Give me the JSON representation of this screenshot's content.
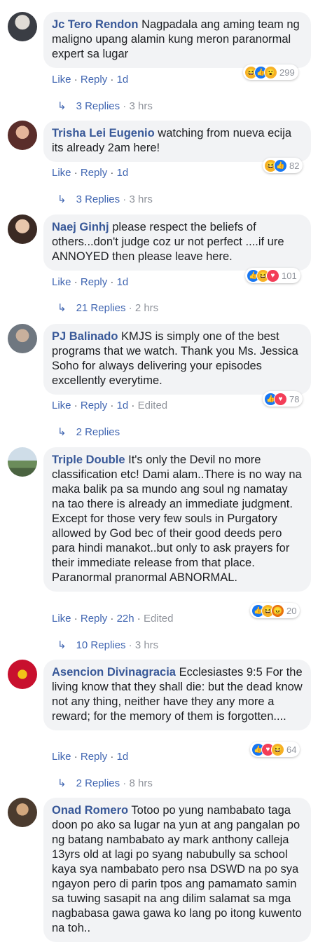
{
  "comments": [
    {
      "author": "Jc Tero Rendon",
      "text": "Nagpadala ang aming team ng maligno upang alamin kung meron paranormal expert sa lugar",
      "reactions": [
        "haha",
        "like",
        "wow"
      ],
      "count": "299",
      "like": "Like",
      "reply": "Reply",
      "time": "1d",
      "edited": "",
      "replies_label": "3 Replies",
      "replies_time": "3 hrs"
    },
    {
      "author": "Trisha Lei Eugenio",
      "text": "watching from nueva ecija its already 2am here!",
      "reactions": [
        "haha",
        "like"
      ],
      "count": "82",
      "like": "Like",
      "reply": "Reply",
      "time": "1d",
      "edited": "",
      "replies_label": "3 Replies",
      "replies_time": "3 hrs"
    },
    {
      "author": "Naej Ginhj",
      "text": "please respect the beliefs of others...don't judge coz ur not perfect ....if ure ANNOYED then please leave here.",
      "reactions": [
        "like",
        "haha",
        "love"
      ],
      "count": "101",
      "like": "Like",
      "reply": "Reply",
      "time": "1d",
      "edited": "",
      "replies_label": "21 Replies",
      "replies_time": "2 hrs"
    },
    {
      "author": "PJ Balinado",
      "text": "KMJS is simply one of the best programs that we watch. Thank you Ms. Jessica Soho for always delivering your episodes excellently everytime.",
      "reactions": [
        "like",
        "love"
      ],
      "count": "78",
      "like": "Like",
      "reply": "Reply",
      "time": "1d",
      "edited": "Edited",
      "replies_label": "2 Replies",
      "replies_time": ""
    },
    {
      "author": "Triple Double",
      "text": "It's only the Devil no more classification etc! Dami alam..There is no way na maka balik pa sa mundo ang soul ng namatay na tao there is already an immediate judgment. Except for those very few souls in Purgatory allowed by God bec of their good deeds pero para hindi manakot..but only to ask prayers for their immediate release from that place. Paranormal pranormal ABNORMAL.",
      "reactions": [
        "like",
        "haha",
        "angry"
      ],
      "count": "20",
      "like": "Like",
      "reply": "Reply",
      "time": "22h",
      "edited": "Edited",
      "replies_label": "10 Replies",
      "replies_time": "3 hrs"
    },
    {
      "author": "Asencion Divinagracia",
      "text": "Ecclesiastes 9:5 For the living know that they shall die: but the dead know not any thing, neither have they any more a reward; for the memory of them is forgotten....",
      "reactions": [
        "like",
        "love",
        "haha"
      ],
      "count": "64",
      "like": "Like",
      "reply": "Reply",
      "time": "1d",
      "edited": "",
      "replies_label": "2 Replies",
      "replies_time": "8 hrs"
    },
    {
      "author": "Onad Romero",
      "text": "Totoo po yung nambabato taga doon po ako sa lugar na yun at ang pangalan po ng batang nambabato ay mark anthony calleja 13yrs old at lagi po syang nabubully sa school kaya sya nambabato pero nsa DSWD na po sya ngayon pero di parin tpos ang pamamato samin sa tuwing sasapit na ang dilim salamat sa mga nagbabasa gawa gawa ko lang po itong kuwento na toh..",
      "reactions": [],
      "count": "",
      "like": "",
      "reply": "",
      "time": "",
      "edited": "",
      "replies_label": "",
      "replies_time": ""
    }
  ],
  "colors": {
    "link": "#385898",
    "bubble": "#f2f3f5",
    "like": "#1877f2",
    "love": "#f33e58",
    "haha": "#f7b125",
    "angry": "#e9710f"
  }
}
